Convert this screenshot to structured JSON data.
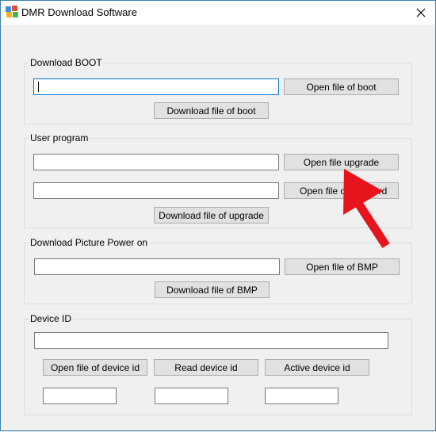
{
  "window": {
    "title": "DMR Download Software",
    "icon": "app-colored-blocks-icon",
    "close_icon": "close-icon"
  },
  "boot": {
    "label": "Download BOOT",
    "path_value": "",
    "open_button": "Open file of boot",
    "download_button": "Download file of boot"
  },
  "user_program": {
    "label": "User program",
    "upgrade_path_value": "",
    "open_upgrade_button": "Open file upgrade",
    "second_path_value": "",
    "open_second_button": "Open file of",
    "open_second_button_tail": "ord",
    "download_button": "Download file of upgrade"
  },
  "picture": {
    "label": "Download Picture Power on",
    "path_value": "",
    "open_button": "Open file of BMP",
    "download_button": "Download file of BMP"
  },
  "device_id": {
    "label": "Device ID",
    "id_value": "",
    "open_button": "Open file of device id",
    "read_button": "Read device id",
    "active_button": "Active device id",
    "box1_value": "",
    "box2_value": "",
    "box3_value": ""
  },
  "colors": {
    "annotation_arrow": "#e8141b",
    "focus_border": "#0078d7",
    "button_face": "#e1e1e1"
  }
}
